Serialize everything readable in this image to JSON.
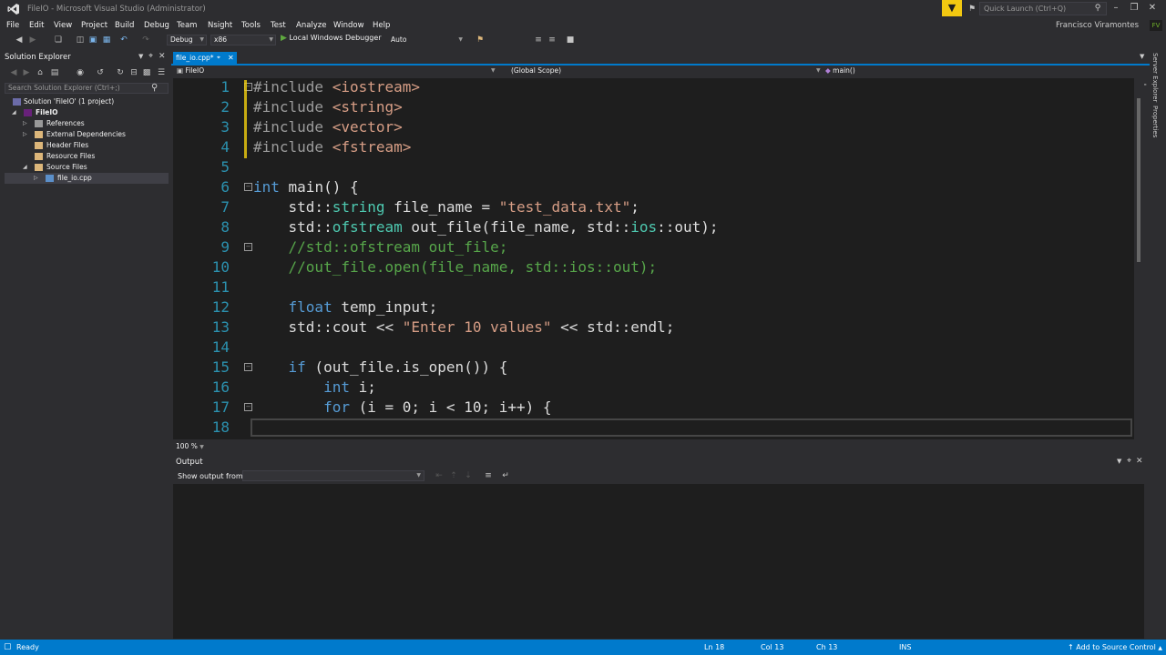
{
  "window": {
    "title": "FileIO - Microsoft Visual Studio (Administrator)",
    "quick_launch_placeholder": "Quick Launch (Ctrl+Q)",
    "account_name": "Francisco Viramontes",
    "avatar_initials": "FV"
  },
  "menu": [
    "File",
    "Edit",
    "View",
    "Project",
    "Build",
    "Debug",
    "Team",
    "Nsight",
    "Tools",
    "Test",
    "Analyze",
    "Window",
    "Help"
  ],
  "toolbar": {
    "config": "Debug",
    "platform": "x86",
    "debugger": "Local Windows Debugger",
    "debug_mode": "Auto"
  },
  "solution_explorer": {
    "title": "Solution Explorer",
    "search_placeholder": "Search Solution Explorer (Ctrl+;)",
    "tree": [
      {
        "label": "Solution 'FileIO' (1 project)",
        "kind": "solution"
      },
      {
        "label": "FileIO",
        "kind": "project"
      },
      {
        "label": "References",
        "kind": "ref"
      },
      {
        "label": "External Dependencies",
        "kind": "folder"
      },
      {
        "label": "Header Files",
        "kind": "folder"
      },
      {
        "label": "Resource Files",
        "kind": "folder"
      },
      {
        "label": "Source Files",
        "kind": "folder"
      },
      {
        "label": "file_io.cpp",
        "kind": "cpp"
      }
    ]
  },
  "editor": {
    "tab_label": "file_io.cpp*",
    "nav_project": "FileIO",
    "nav_scope": "(Global Scope)",
    "nav_member": "main()",
    "zoom": "100 %",
    "line_numbers": [
      "1",
      "2",
      "3",
      "4",
      "5",
      "6",
      "7",
      "8",
      "9",
      "10",
      "11",
      "12",
      "13",
      "14",
      "15",
      "16",
      "17",
      "18"
    ],
    "lines": [
      "#include <iostream>",
      "#include <string>",
      "#include <vector>",
      "#include <fstream>",
      "",
      "int main() {",
      "    std::string file_name = \"test_data.txt\";",
      "    std::ofstream out_file(file_name, std::ios::out);",
      "    //std::ofstream out_file;",
      "    //out_file.open(file_name, std::ios::out);",
      "",
      "    float temp_input;",
      "    std::cout << \"Enter 10 values\" << std::endl;",
      "",
      "    if (out_file.is_open()) {",
      "        int i;",
      "        for (i = 0; i < 10; i++) {",
      ""
    ]
  },
  "output": {
    "title": "Output",
    "show_output_from": "Show output from:"
  },
  "side_tabs": [
    "Server Explorer",
    "Properties"
  ],
  "statusbar": {
    "ready": "Ready",
    "line": "Ln 18",
    "col": "Col 13",
    "ch": "Ch 13",
    "mode": "INS",
    "source_control": "Add to Source Control"
  }
}
